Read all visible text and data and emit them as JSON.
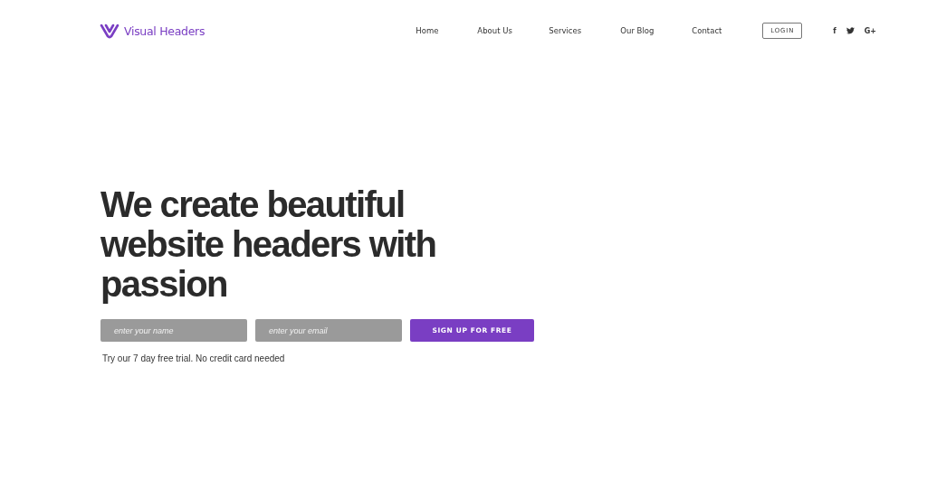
{
  "brand": {
    "name": "Visual Headers"
  },
  "nav": [
    {
      "label": "Home"
    },
    {
      "label": "About Us"
    },
    {
      "label": "Services"
    },
    {
      "label": "Our Blog"
    },
    {
      "label": "Contact"
    }
  ],
  "login": {
    "label": "LOGIN"
  },
  "social": [
    {
      "kind": "text",
      "label": "f"
    },
    {
      "kind": "bird"
    },
    {
      "kind": "text",
      "label": "G+"
    }
  ],
  "hero": {
    "heading": "We create beautiful website headers with passion",
    "fields": [
      {
        "placeholder": "enter your name"
      },
      {
        "placeholder": "enter your email"
      }
    ],
    "button": "SIGN UP FOR FREE",
    "note": "Try our 7 day free trial. No credit card needed"
  }
}
